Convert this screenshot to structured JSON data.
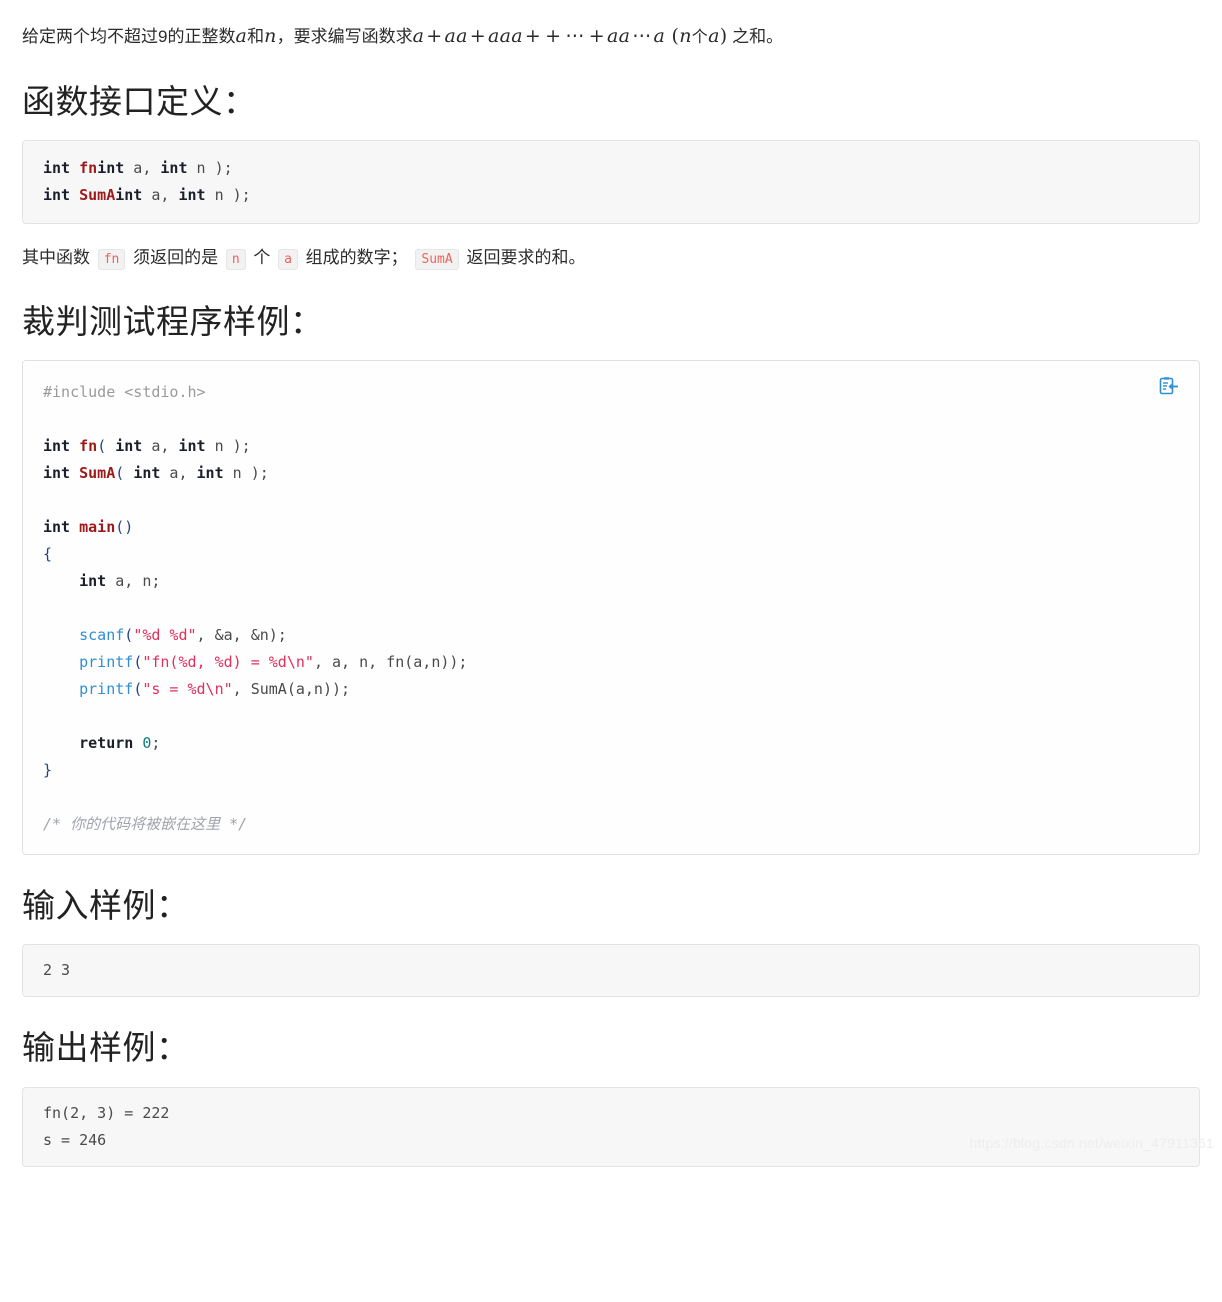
{
  "intro": {
    "lead": "给定两个均不超过9的正整数",
    "var_a": "a",
    "and": "和",
    "var_n": "n",
    "mid": "，要求编写函数求",
    "formula_plain": "a + aa + aaa + + ⋯ + aa⋯a",
    "f_a1": "a",
    "f_plus1": "+",
    "f_aa": "aa",
    "f_plus2": "+",
    "f_aaa": "aaa",
    "f_plus3": "+",
    "f_plus4": "+",
    "f_dots": "⋯",
    "f_plus5": "+",
    "f_aa2": "aa",
    "f_dots2": "⋯",
    "f_a2": "a",
    "f_lparen": "(",
    "f_n": "n",
    "f_ge": "个",
    "f_a3": "a",
    "f_rparen": ")",
    "tail": "之和。"
  },
  "sections": {
    "interface_heading": "函数接口定义：",
    "judge_heading": "裁判测试程序样例：",
    "input_heading": "输入样例：",
    "output_heading": "输出样例："
  },
  "interface_code": {
    "line1_kw1": "int",
    "line1_fn": "fn",
    "line1_rest": "( int a, int n );",
    "line1_kw2": "int",
    "line1_plain_a": " a, ",
    "line1_kw3": "int",
    "line1_plain_n": " n );",
    "line2_kw1": "int",
    "line2_fn": "SumA",
    "line2_kw2": "int",
    "line2_plain_a": " a, ",
    "line2_kw3": "int",
    "line2_plain_n": " n );"
  },
  "judge_code": {
    "include": "#include <stdio.h>",
    "decl1_kw": "int",
    "decl1_fn": "fn",
    "decl2_kw": "int",
    "decl2_fn": "SumA",
    "params_open": "( ",
    "params_int": "int",
    "params_a": " a, ",
    "params_int2": "int",
    "params_n": " n );",
    "main_kw": "int",
    "main_fn": "main",
    "main_parens": "()",
    "brace_open": "{",
    "vardecl_kw": "int",
    "vardecl_rest": " a, n;",
    "scanf_name": "scanf",
    "scanf_open": "(",
    "scanf_str": "\"%d %d\"",
    "scanf_rest": ", &a, &n);",
    "printf1_name": "printf",
    "printf1_open": "(",
    "printf1_str": "\"fn(%d, %d) = %d\\n\"",
    "printf1_rest": ", a, n, fn(a,n));",
    "printf2_name": "printf",
    "printf2_open": "(",
    "printf2_str": "\"s = %d\\n\"",
    "printf2_rest": ", SumA(a,n));",
    "return_kw": "return",
    "return_num": "0",
    "return_semi": ";",
    "brace_close": "}",
    "comment": "/* 你的代码将被嵌在这里 */",
    "copy_icon": "copy-clipboard-icon"
  },
  "input_sample": {
    "line1": "2 3"
  },
  "output_sample": {
    "line1": "fn(2, 3) = 222",
    "line2": "s = 246"
  },
  "watermark": {
    "text": "https://blog.csdn.net/weixin_47911361"
  },
  "colors": {
    "accent_blue": "#2f8fd4",
    "keyword": "#1b1f2b",
    "function": "#9c1a1a",
    "string": "#e0305c",
    "number": "#127a7a",
    "comment": "#a0a4ac",
    "inline_code": "#f2625c",
    "code_bg": "#f7f7f7",
    "border": "#e3e3e3"
  }
}
